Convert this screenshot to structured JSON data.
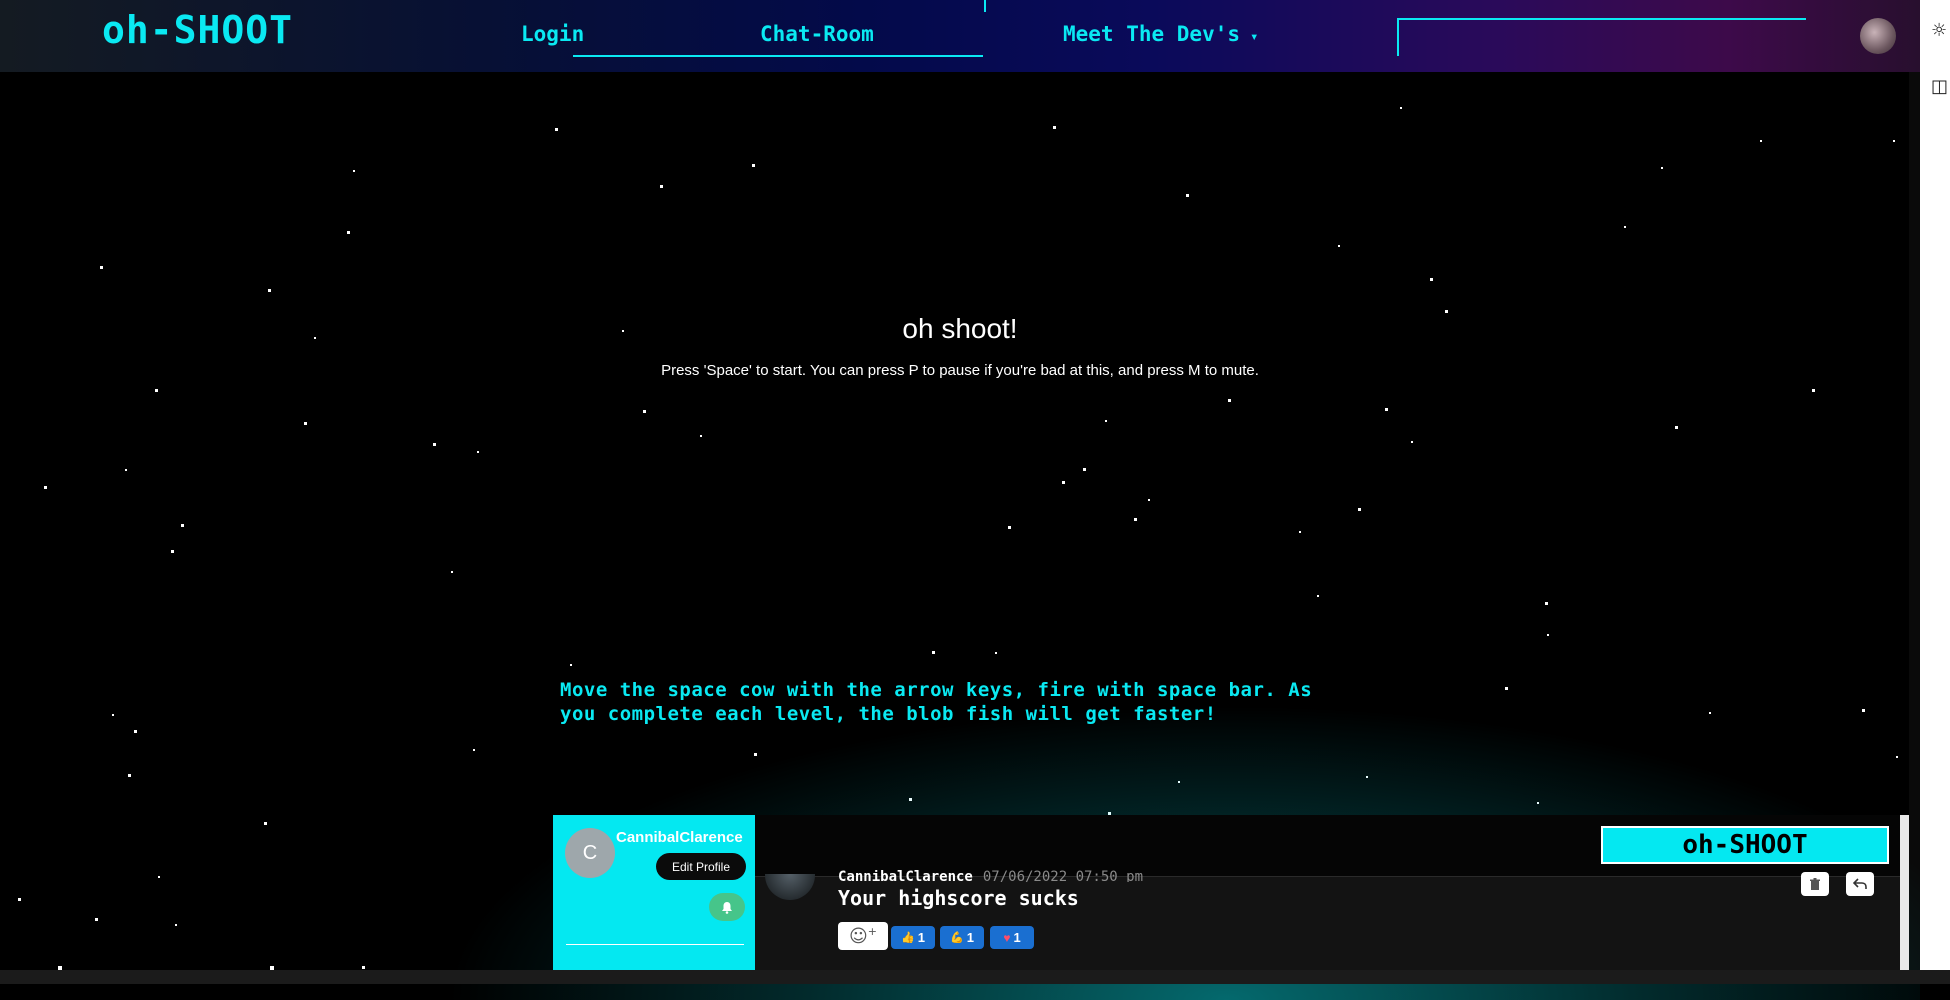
{
  "nav": {
    "brand": "oh-SHOOT",
    "links": [
      "Login",
      "Chat-Room",
      "Meet The Dev's"
    ],
    "dropdown_caret": "▾"
  },
  "game": {
    "title": "oh shoot!",
    "subtitle": "Press 'Space' to start. You can press P to pause if you're bad at this, and press M to mute.",
    "instructions": "Move the space cow with the arrow keys, fire with space bar. As you complete each level, the blob fish will get faster!"
  },
  "chat": {
    "user_initial": "C",
    "username": "CannibalClarence",
    "edit_profile_label": "Edit Profile",
    "bell_icon": "bell-icon",
    "brand": "oh-SHOOT",
    "message": {
      "author": "CannibalClarence",
      "date": "07/06/2022 07:50 pm",
      "text": "Your highscore sucks"
    },
    "reactions": [
      {
        "emoji": "👍",
        "count": "1"
      },
      {
        "emoji": "💪",
        "count": "1"
      },
      {
        "emoji": "♥",
        "count": "1"
      }
    ]
  },
  "colors": {
    "accent": "#0ae9f2",
    "reaction": "#1a6fd1",
    "bell": "#46c58a"
  }
}
